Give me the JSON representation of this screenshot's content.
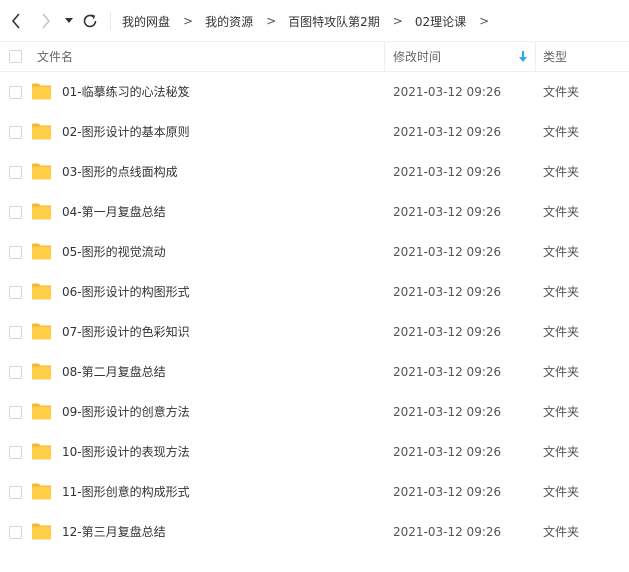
{
  "breadcrumb": {
    "items": [
      "我的网盘",
      "我的资源",
      "百图特攻队第2期",
      "02理论课"
    ],
    "separator": ">"
  },
  "columns": {
    "name": "文件名",
    "modified": "修改时间",
    "type": "类型"
  },
  "sort": {
    "column": "modified",
    "direction": "descending",
    "icon": "sort-down-arrow-icon"
  },
  "colors": {
    "folder": "#FFCF4A",
    "folder_back": "#F5B93A",
    "sort_arrow": "#2FA3F6"
  },
  "files": [
    {
      "name": "01-临摹练习的心法秘笈",
      "modified": "2021-03-12 09:26",
      "type": "文件夹"
    },
    {
      "name": "02-图形设计的基本原则",
      "modified": "2021-03-12 09:26",
      "type": "文件夹"
    },
    {
      "name": "03-图形的点线面构成",
      "modified": "2021-03-12 09:26",
      "type": "文件夹"
    },
    {
      "name": "04-第一月复盘总结",
      "modified": "2021-03-12 09:26",
      "type": "文件夹"
    },
    {
      "name": "05-图形的视觉流动",
      "modified": "2021-03-12 09:26",
      "type": "文件夹"
    },
    {
      "name": "06-图形设计的构图形式",
      "modified": "2021-03-12 09:26",
      "type": "文件夹"
    },
    {
      "name": "07-图形设计的色彩知识",
      "modified": "2021-03-12 09:26",
      "type": "文件夹"
    },
    {
      "name": "08-第二月复盘总结",
      "modified": "2021-03-12 09:26",
      "type": "文件夹"
    },
    {
      "name": "09-图形设计的创意方法",
      "modified": "2021-03-12 09:26",
      "type": "文件夹"
    },
    {
      "name": "10-图形设计的表现方法",
      "modified": "2021-03-12 09:26",
      "type": "文件夹"
    },
    {
      "name": "11-图形创意的构成形式",
      "modified": "2021-03-12 09:26",
      "type": "文件夹"
    },
    {
      "name": "12-第三月复盘总结",
      "modified": "2021-03-12 09:26",
      "type": "文件夹"
    }
  ]
}
